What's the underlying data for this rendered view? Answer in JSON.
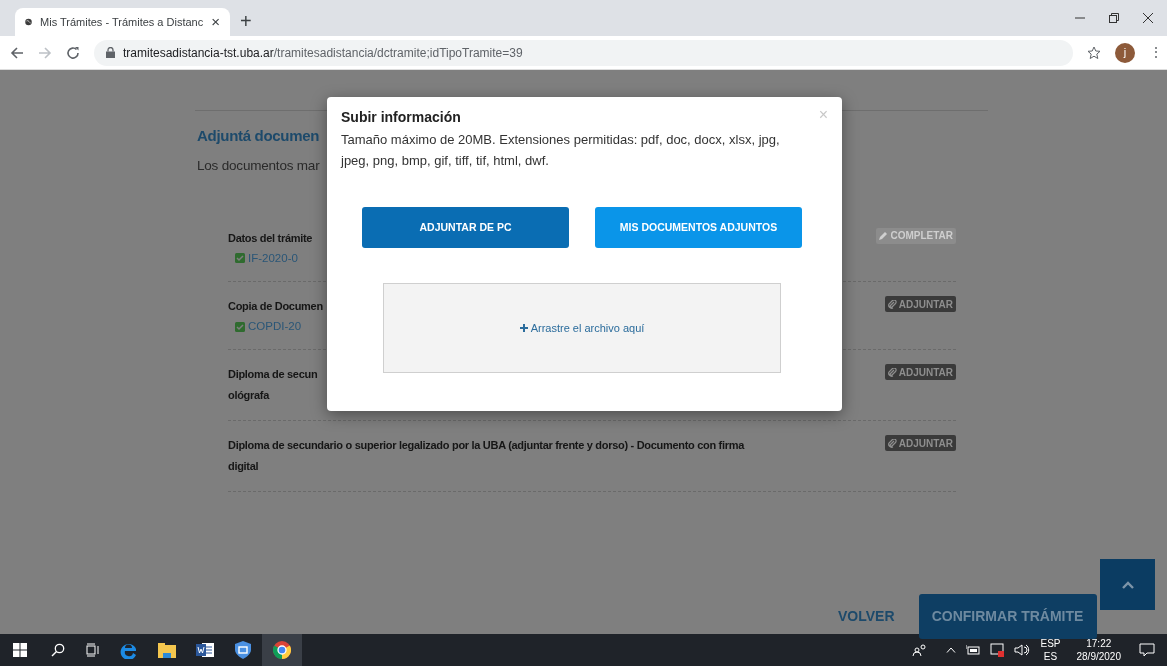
{
  "browser": {
    "tab": {
      "title": "Mis Trámites - Trámites a Distanc",
      "close": "×"
    },
    "new_tab": "+",
    "url": {
      "host": "tramitesadistancia-tst.uba.ar",
      "path": "/tramitesadistancia/dctramite;idTipoTramite=39"
    },
    "profile_initial": "j",
    "menu": "⋮"
  },
  "page": {
    "heading": "Adjuntá documen",
    "intro": "Los documentos mar",
    "items": [
      {
        "title_lines": [
          "Datos del trámite"
        ],
        "attachment": "IF-2020-0",
        "action": {
          "label": "COMPLETAR",
          "kind": "edit",
          "disabled": true
        }
      },
      {
        "title_lines": [
          "Copia de Documen"
        ],
        "attachment": "COPDI-20",
        "action": {
          "label": "ADJUNTAR",
          "kind": "attach",
          "disabled": false
        }
      },
      {
        "title_lines": [
          "Diploma de secun",
          "ológrafa"
        ],
        "action": {
          "label": "ADJUNTAR",
          "kind": "attach",
          "disabled": false
        }
      },
      {
        "title_lines": [
          "Diploma de secundario o superior legalizado por la UBA (adjuntar frente y dorso) - Documento con firma",
          "digital"
        ],
        "action": {
          "label": "ADJUNTAR",
          "kind": "attach",
          "disabled": false
        }
      }
    ],
    "back": "VOLVER",
    "confirm": "CONFIRMAR TRÁMITE"
  },
  "modal": {
    "title": "Subir información",
    "description": "Tamaño máximo de 20MB. Extensiones permitidas: pdf, doc, docx, xlsx, jpg, jpeg, png, bmp, gif, tiff, tif, html, dwf.",
    "close": "×",
    "buttons": [
      {
        "label": "ADJUNTAR DE PC",
        "kind": "primary"
      },
      {
        "label": "MIS DOCUMENTOS ADJUNTOS",
        "kind": "secondary"
      }
    ],
    "dropzone": "Arrastre el archivo aquí"
  },
  "taskbar": {
    "language": [
      "ESP",
      "ES"
    ],
    "time": "17:22",
    "date": "28/9/2020"
  }
}
